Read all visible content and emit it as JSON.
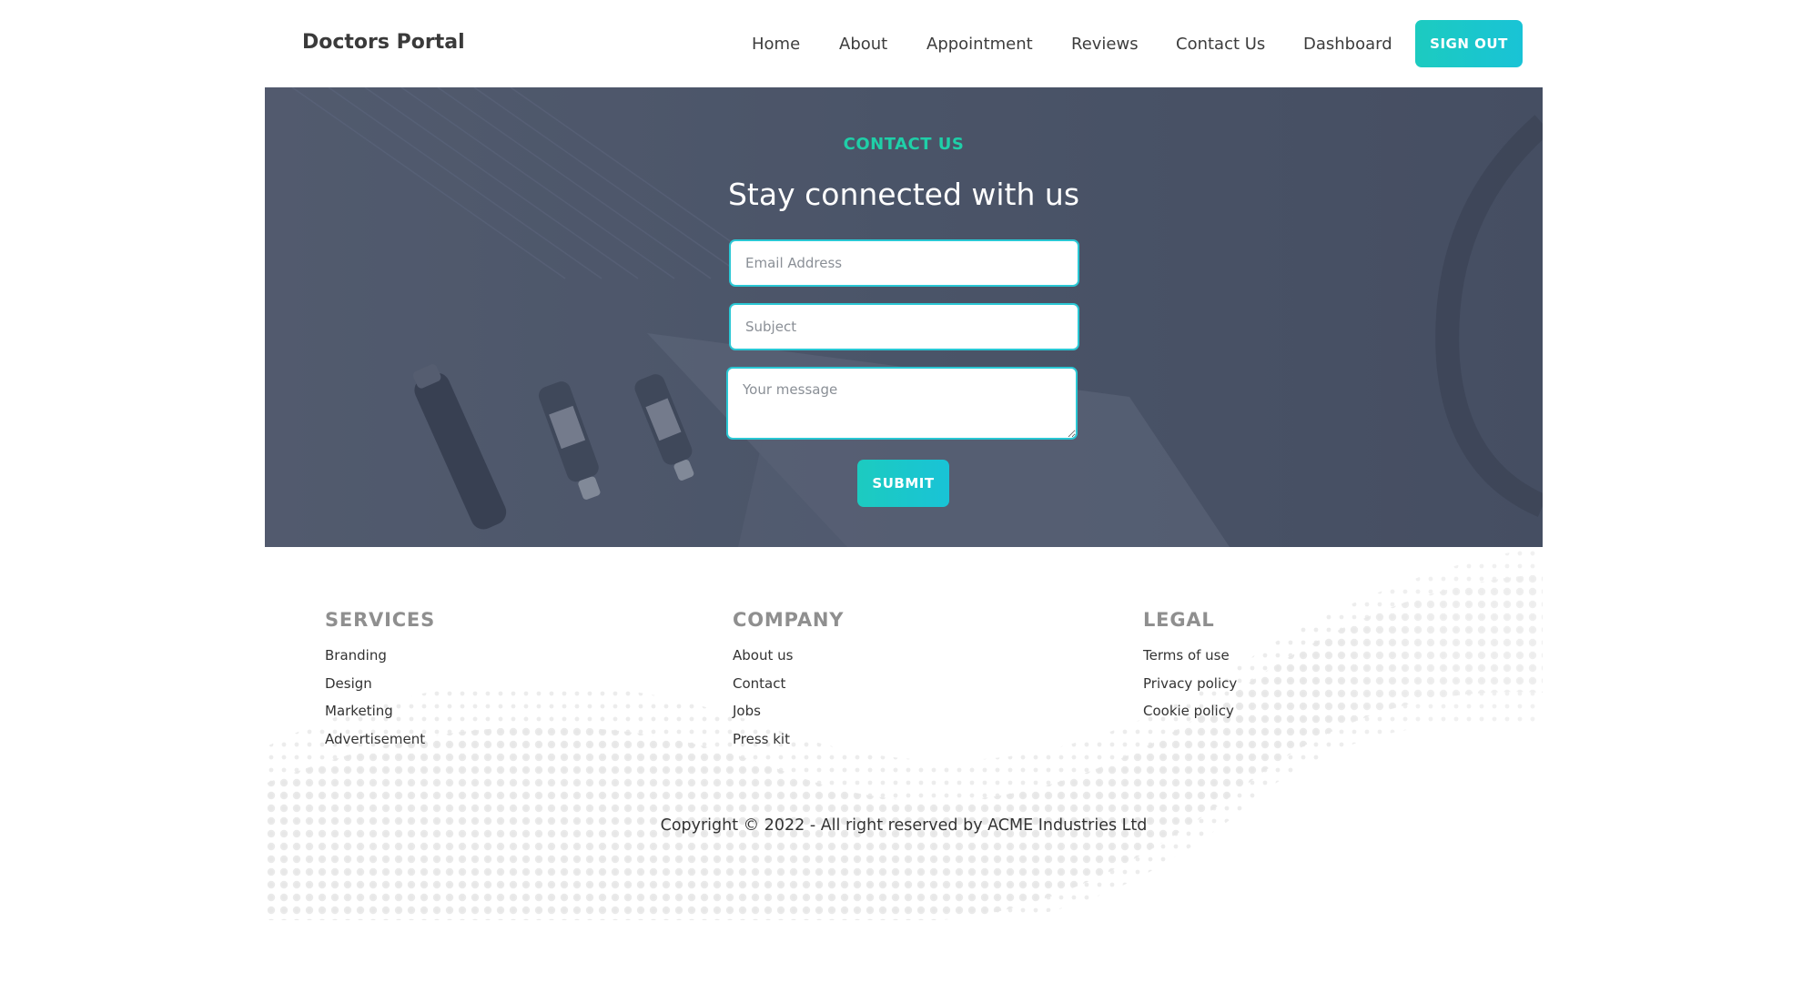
{
  "navbar": {
    "brand": "Doctors Portal",
    "links": [
      {
        "label": "Home"
      },
      {
        "label": "About"
      },
      {
        "label": "Appointment"
      },
      {
        "label": "Reviews"
      },
      {
        "label": "Contact Us"
      },
      {
        "label": "Dashboard"
      }
    ],
    "signout_label": "SIGN OUT"
  },
  "contact": {
    "eyebrow": "CONTACT US",
    "heading": "Stay connected with us",
    "email_placeholder": "Email Address",
    "subject_placeholder": "Subject",
    "message_placeholder": "Your message",
    "submit_label": "SUBMIT"
  },
  "footer": {
    "services": {
      "title": "SERVICES",
      "items": [
        "Branding",
        "Design",
        "Marketing",
        "Advertisement"
      ]
    },
    "company": {
      "title": "COMPANY",
      "items": [
        "About us",
        "Contact",
        "Jobs",
        "Press kit"
      ]
    },
    "legal": {
      "title": "LEGAL",
      "items": [
        "Terms of use",
        "Privacy policy",
        "Cookie policy"
      ]
    },
    "copyright": "Copyright © 2022 - All right reserved by ACME Industries Ltd"
  },
  "colors": {
    "accent": "#1ccbc0",
    "accent_alt": "#19c3d6",
    "eyebrow": "#1fcfa8",
    "hero_bg": "#4a5468"
  }
}
